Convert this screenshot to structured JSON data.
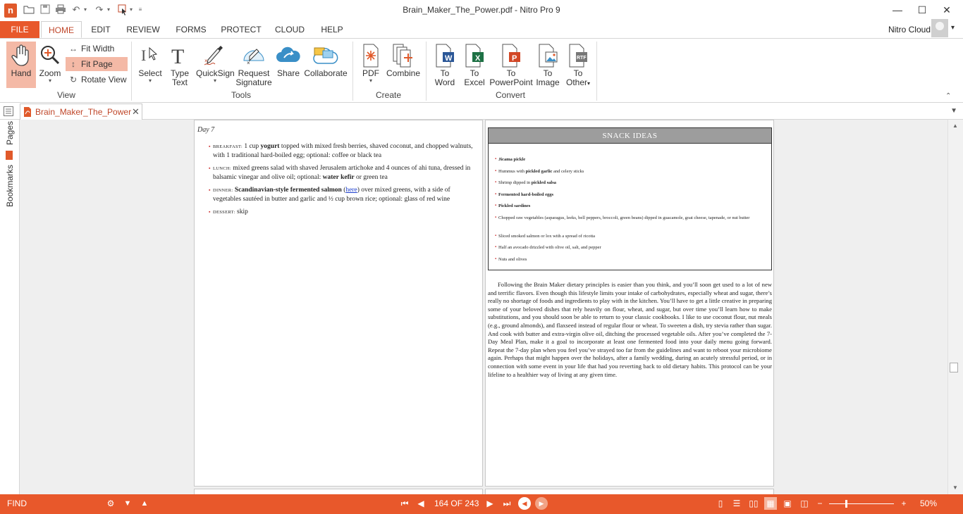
{
  "window": {
    "title": "Brain_Maker_The_Power.pdf - Nitro Pro 9",
    "minimize": "—",
    "maximize": "☐",
    "close": "✕"
  },
  "quick_access": [
    "open",
    "save",
    "print",
    "undo",
    "redo",
    "select-tool",
    "customize"
  ],
  "ribbon_tabs": {
    "file": "FILE",
    "tabs": [
      "HOME",
      "EDIT",
      "REVIEW",
      "FORMS",
      "PROTECT",
      "CLOUD",
      "HELP"
    ],
    "active": "HOME"
  },
  "account": {
    "label": "Nitro Cloud"
  },
  "ribbon": {
    "view": {
      "label": "View",
      "hand": "Hand",
      "zoom": "Zoom",
      "fit_width": "Fit Width",
      "fit_page": "Fit Page",
      "rotate_view": "Rotate View"
    },
    "tools": {
      "label": "Tools",
      "select": "Select",
      "type_text_1": "Type",
      "type_text_2": "Text",
      "quicksign": "QuickSign",
      "request_1": "Request",
      "request_2": "Signature",
      "share": "Share",
      "collaborate": "Collaborate"
    },
    "create": {
      "label": "Create",
      "pdf": "PDF",
      "combine": "Combine"
    },
    "convert": {
      "label": "Convert",
      "to_word_1": "To",
      "to_word_2": "Word",
      "to_excel_1": "To",
      "to_excel_2": "Excel",
      "to_ppt_1": "To",
      "to_ppt_2": "PowerPoint",
      "to_image_1": "To",
      "to_image_2": "Image",
      "to_other_1": "To",
      "to_other_2": "Other"
    }
  },
  "document_tab": {
    "label": "Brain_Maker_The_Power"
  },
  "side_panel": {
    "pages": "Pages",
    "bookmarks": "Bookmarks"
  },
  "left_page": {
    "day": "Day 7",
    "meals": [
      {
        "label": "BREAKFAST:",
        "pre": " 1 cup ",
        "bold": "yogurt",
        "post": " topped with mixed fresh berries, shaved coconut, and chopped walnuts, with 1 traditional hard-boiled egg; optional: coffee or black tea"
      },
      {
        "label": "LUNCH:",
        "pre": " mixed greens salad with shaved Jerusalem artichoke and 4 ounces of ahi tuna, dressed in balsamic vinegar and olive oil; optional: ",
        "bold": "water kefir",
        "post": " or green tea"
      },
      {
        "label": "DINNER:",
        "pre": " ",
        "bold": "Scandinavian-style fermented salmon",
        "link": "here",
        "post": " over mixed greens, with a side of vegetables sautéed in butter and garlic and ½ cup brown rice; optional: glass of red wine"
      },
      {
        "label": "DESSERT:",
        "pre": " skip",
        "bold": "",
        "post": ""
      }
    ]
  },
  "right_page": {
    "snack_title": "SNACK IDEAS",
    "snacks": [
      {
        "pre": "",
        "bold": "Jicama pickle",
        "post": ""
      },
      {
        "pre": "Hummus with ",
        "bold": "pickled garlic",
        "post": " and celery sticks"
      },
      {
        "pre": "Shrimp dipped in ",
        "bold": "pickled salsa",
        "post": ""
      },
      {
        "pre": "",
        "bold": "Fermented hard-boiled eggs",
        "post": ""
      },
      {
        "pre": "",
        "bold": "Pickled sardines",
        "post": ""
      },
      {
        "pre": "Chopped raw vegetables (asparagus, leeks, bell peppers, broccoli, green beans) dipped in guacamole, goat cheese, tapenade, or nut butter",
        "bold": "",
        "post": ""
      },
      {
        "pre": "Sliced smoked salmon or lox with a spread of ricotta",
        "bold": "",
        "post": ""
      },
      {
        "pre": "Half an avocado drizzled with olive oil, salt, and pepper",
        "bold": "",
        "post": ""
      },
      {
        "pre": "Nuts and olives",
        "bold": "",
        "post": ""
      }
    ],
    "paragraph": "Following the Brain Maker dietary principles is easier than you think, and you’ll soon get used to a lot of new and terrific flavors. Even though this lifestyle limits your intake of carbohydrates, especially wheat and sugar, there’s really no shortage of foods and ingredients to play with in the kitchen. You’ll have to get a little creative in preparing some of your beloved dishes that rely heavily on flour, wheat, and sugar, but over time you’ll learn how to make substitutions, and you should soon be able to return to your classic cookbooks. I like to use coconut flour, nut meals (e.g., ground almonds), and flaxseed instead of regular flour or wheat. To sweeten a dish, try stevia rather than sugar. And cook with butter and extra-virgin olive oil, ditching the processed vegetable oils. After you’ve completed the 7-Day Meal Plan, make it a goal to incorporate at least one fermented food into your daily menu going forward. Repeat the 7-day plan when you feel you’ve strayed too far from the guidelines and want to reboot your microbiome again. Perhaps that might happen over the holidays, after a family wedding, during an acutely stressful period, or in connection with some event in your life that had you reverting back to old dietary habits. This protocol can be your lifeline to a healthier way of living at any given time."
  },
  "statusbar": {
    "find": "FIND",
    "page_indicator": "164 OF 243",
    "zoom": "50%",
    "zoom_fraction": 0.5,
    "accent": "#e8582b"
  }
}
